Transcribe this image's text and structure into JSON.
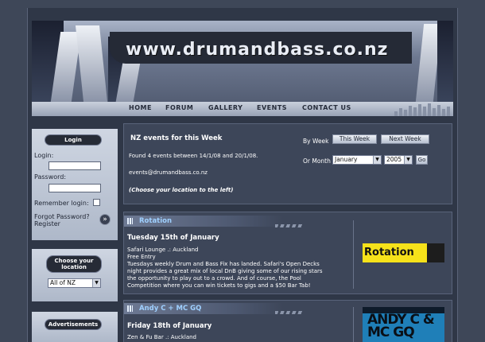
{
  "site": {
    "logo_text": "www.drumandbass.co.nz"
  },
  "nav": {
    "items": [
      {
        "label": "HOME"
      },
      {
        "label": "FORUM"
      },
      {
        "label": "GALLERY"
      },
      {
        "label": "EVENTS"
      },
      {
        "label": "CONTACT US"
      }
    ]
  },
  "login": {
    "title": "Login",
    "login_label": "Login:",
    "password_label": "Password:",
    "remember_label": "Remember login:",
    "forgot_label": "Forgot Password?",
    "register_label": "Register",
    "submit_icon": "»"
  },
  "location": {
    "title": "Choose your location",
    "selected": "All of NZ"
  },
  "ads": {
    "title": "Advertisements"
  },
  "events_header": {
    "title": "NZ events for this Week",
    "found_text": "Found 4 events between 14/1/08 and 20/1/08.",
    "email": "events@drumandbass.co.nz",
    "hint": "(Choose your location to the left)",
    "by_week_label": "By Week",
    "this_week_label": "This Week",
    "next_week_label": "Next Week",
    "or_month_label": "Or Month",
    "month_selected": "January",
    "year_selected": "2005",
    "go_label": "Go"
  },
  "events": [
    {
      "title": "Rotation",
      "date": "Tuesday 15th of January",
      "venue": "Safari Lounge .: Auckland",
      "entry": "Free Entry",
      "desc1": "Tuesdays weekly Drum and Bass Fix has landed. Safari's Open Decks",
      "desc2": "night provides a great mix of local DnB giving some of our rising stars",
      "desc3": "the opportunity to play out to a crowd. And of course, the Pool",
      "desc4": "Competition where you can win tickets to gigs and a $50 Bar Tab!",
      "banner_text": "Rotation"
    },
    {
      "title": "Andy C + MC GQ",
      "date": "Friday 18th of January",
      "venue": "Zen & Fu Bar .: Auckland",
      "banner_text": "ANDY C & MC GQ"
    }
  ],
  "colors": {
    "background": "#3e4758",
    "panel": "#3d4659",
    "accent_title": "#9fd0ff",
    "rotation_banner": "#f6e21a",
    "andy_banner": "#1f7fb8"
  }
}
